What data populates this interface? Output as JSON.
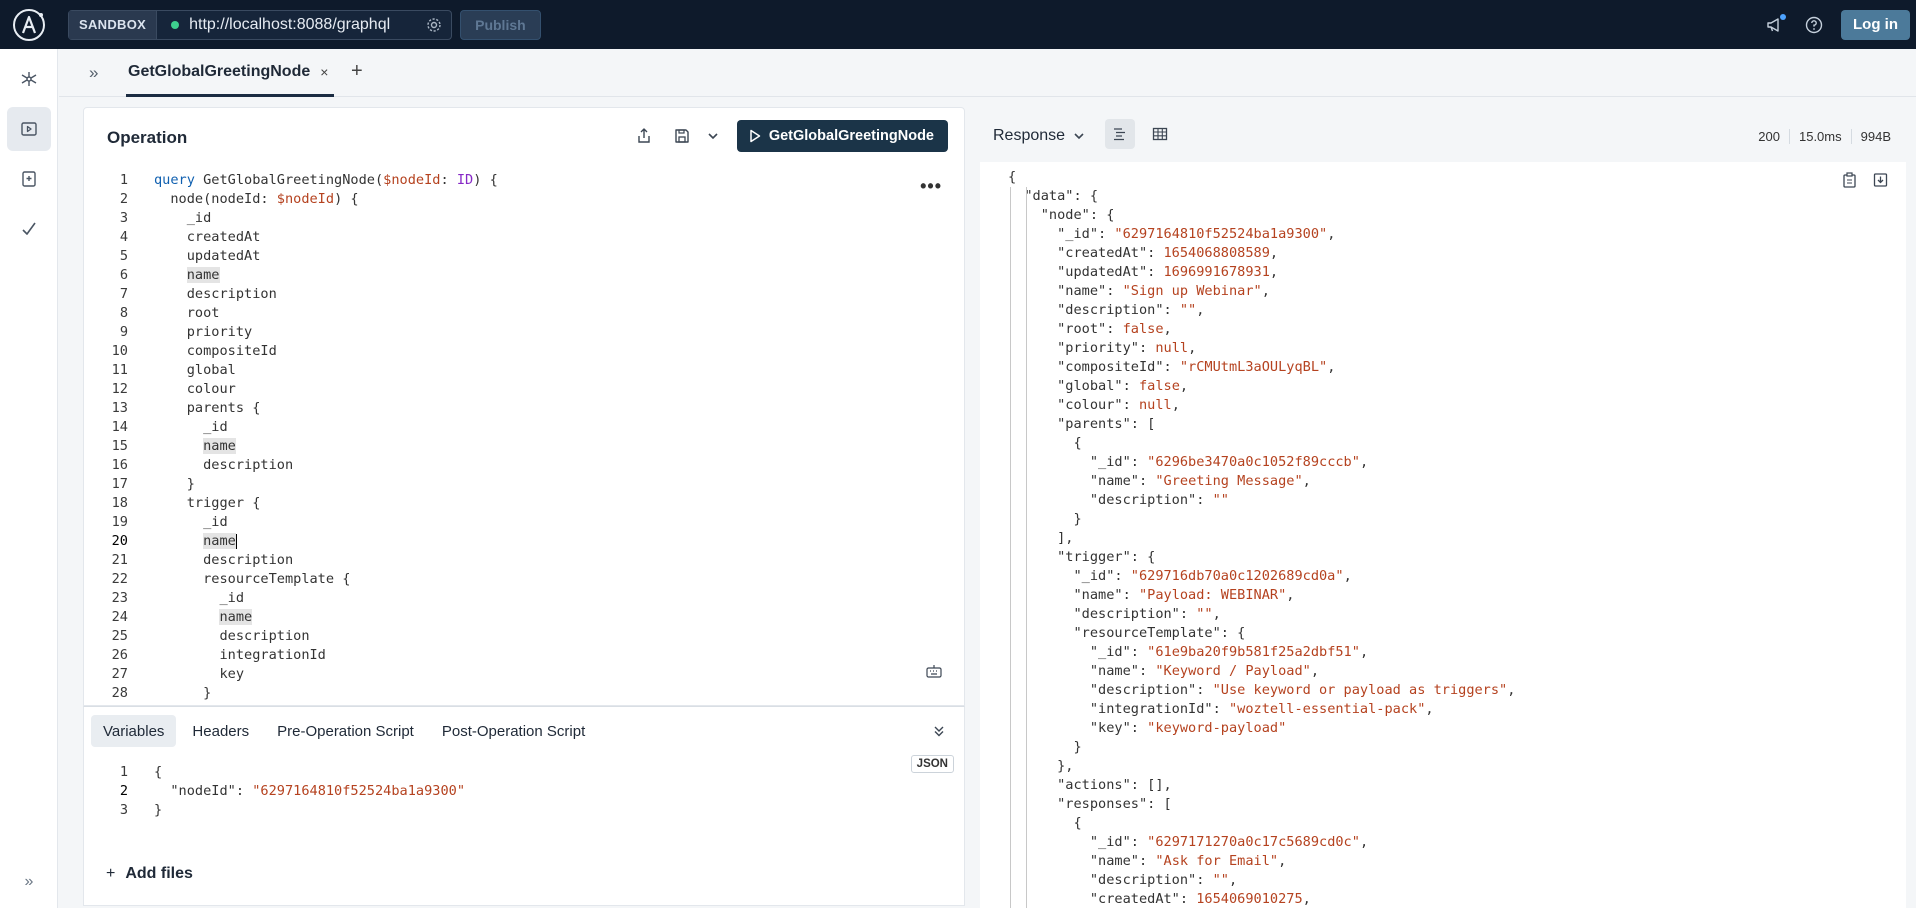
{
  "topbar": {
    "sandbox_label": "SANDBOX",
    "url": "http://localhost:8088/graphql",
    "publish_label": "Publish",
    "login_label": "Log in"
  },
  "tabs": [
    {
      "label": "GetGlobalGreetingNode",
      "close": "×"
    }
  ],
  "operation": {
    "title": "Operation",
    "run_label": "GetGlobalGreetingNode",
    "more": "•••",
    "code_lines": [
      [
        [
          "kw",
          "query"
        ],
        [
          "p",
          " GetGlobalGreetingNode("
        ],
        [
          "var",
          "$nodeId"
        ],
        [
          "p",
          ": "
        ],
        [
          "typ",
          "ID"
        ],
        [
          "p",
          ") {"
        ]
      ],
      [
        [
          "p",
          "  node(nodeId: "
        ],
        [
          "var",
          "$nodeId"
        ],
        [
          "p",
          ") {"
        ]
      ],
      [
        [
          "p",
          "    _id"
        ]
      ],
      [
        [
          "p",
          "    createdAt"
        ]
      ],
      [
        [
          "p",
          "    updatedAt"
        ]
      ],
      [
        [
          "p",
          "    "
        ],
        [
          "hl",
          "name"
        ]
      ],
      [
        [
          "p",
          "    description"
        ]
      ],
      [
        [
          "p",
          "    root"
        ]
      ],
      [
        [
          "p",
          "    priority"
        ]
      ],
      [
        [
          "p",
          "    compositeId"
        ]
      ],
      [
        [
          "p",
          "    global"
        ]
      ],
      [
        [
          "p",
          "    colour"
        ]
      ],
      [
        [
          "p",
          "    parents {"
        ]
      ],
      [
        [
          "p",
          "      _id"
        ]
      ],
      [
        [
          "p",
          "      "
        ],
        [
          "hl",
          "name"
        ]
      ],
      [
        [
          "p",
          "      description"
        ]
      ],
      [
        [
          "p",
          "    }"
        ]
      ],
      [
        [
          "p",
          "    trigger {"
        ]
      ],
      [
        [
          "p",
          "      _id"
        ]
      ],
      [
        [
          "p",
          "      "
        ],
        [
          "hl",
          "name"
        ],
        [
          "caret",
          ""
        ]
      ],
      [
        [
          "p",
          "      description"
        ]
      ],
      [
        [
          "p",
          "      resourceTemplate {"
        ]
      ],
      [
        [
          "p",
          "        _id"
        ]
      ],
      [
        [
          "p",
          "        "
        ],
        [
          "hl",
          "name"
        ]
      ],
      [
        [
          "p",
          "        description"
        ]
      ],
      [
        [
          "p",
          "        integrationId"
        ]
      ],
      [
        [
          "p",
          "        key"
        ]
      ],
      [
        [
          "p",
          "      }"
        ]
      ]
    ]
  },
  "variables": {
    "tabs": [
      "Variables",
      "Headers",
      "Pre-Operation Script",
      "Post-Operation Script"
    ],
    "badge": "JSON",
    "code_lines": [
      [
        [
          "p",
          "{"
        ]
      ],
      [
        [
          "p",
          "  \"nodeId\": "
        ],
        [
          "str",
          "\"6297164810f52524ba1a9300\""
        ]
      ],
      [
        [
          "p",
          "}"
        ]
      ]
    ],
    "add_files_label": "Add files"
  },
  "response": {
    "label": "Response",
    "status": "200",
    "time": "15.0ms",
    "size": "994B",
    "lines": [
      [
        [
          "p",
          "{"
        ]
      ],
      [
        [
          "p",
          "  \"data\": {"
        ]
      ],
      [
        [
          "p",
          "    \"node\": {"
        ]
      ],
      [
        [
          "p",
          "      \"_id\": "
        ],
        [
          "str",
          "\"6297164810f52524ba1a9300\""
        ],
        [
          "p",
          ","
        ]
      ],
      [
        [
          "p",
          "      \"createdAt\": "
        ],
        [
          "str",
          "1654068808589"
        ],
        [
          "p",
          ","
        ]
      ],
      [
        [
          "p",
          "      \"updatedAt\": "
        ],
        [
          "str",
          "1696991678931"
        ],
        [
          "p",
          ","
        ]
      ],
      [
        [
          "p",
          "      \"name\": "
        ],
        [
          "str",
          "\"Sign up Webinar\""
        ],
        [
          "p",
          ","
        ]
      ],
      [
        [
          "p",
          "      \"description\": "
        ],
        [
          "str",
          "\"\""
        ],
        [
          "p",
          ","
        ]
      ],
      [
        [
          "p",
          "      \"root\": "
        ],
        [
          "str",
          "false"
        ],
        [
          "p",
          ","
        ]
      ],
      [
        [
          "p",
          "      \"priority\": "
        ],
        [
          "str",
          "null"
        ],
        [
          "p",
          ","
        ]
      ],
      [
        [
          "p",
          "      \"compositeId\": "
        ],
        [
          "str",
          "\"rCMUtmL3aOULyqBL\""
        ],
        [
          "p",
          ","
        ]
      ],
      [
        [
          "p",
          "      \"global\": "
        ],
        [
          "str",
          "false"
        ],
        [
          "p",
          ","
        ]
      ],
      [
        [
          "p",
          "      \"colour\": "
        ],
        [
          "str",
          "null"
        ],
        [
          "p",
          ","
        ]
      ],
      [
        [
          "p",
          "      \"parents\": ["
        ]
      ],
      [
        [
          "p",
          "        {"
        ]
      ],
      [
        [
          "p",
          "          \"_id\": "
        ],
        [
          "str",
          "\"6296be3470a0c1052f89cccb\""
        ],
        [
          "p",
          ","
        ]
      ],
      [
        [
          "p",
          "          \"name\": "
        ],
        [
          "str",
          "\"Greeting Message\""
        ],
        [
          "p",
          ","
        ]
      ],
      [
        [
          "p",
          "          \"description\": "
        ],
        [
          "str",
          "\"\""
        ]
      ],
      [
        [
          "p",
          "        }"
        ]
      ],
      [
        [
          "p",
          "      ],"
        ]
      ],
      [
        [
          "p",
          "      \"trigger\": {"
        ]
      ],
      [
        [
          "p",
          "        \"_id\": "
        ],
        [
          "str",
          "\"629716db70a0c1202689cd0a\""
        ],
        [
          "p",
          ","
        ]
      ],
      [
        [
          "p",
          "        \"name\": "
        ],
        [
          "str",
          "\"Payload: WEBINAR\""
        ],
        [
          "p",
          ","
        ]
      ],
      [
        [
          "p",
          "        \"description\": "
        ],
        [
          "str",
          "\"\""
        ],
        [
          "p",
          ","
        ]
      ],
      [
        [
          "p",
          "        \"resourceTemplate\": {"
        ]
      ],
      [
        [
          "p",
          "          \"_id\": "
        ],
        [
          "str",
          "\"61e9ba20f9b581f25a2dbf51\""
        ],
        [
          "p",
          ","
        ]
      ],
      [
        [
          "p",
          "          \"name\": "
        ],
        [
          "str",
          "\"Keyword / Payload\""
        ],
        [
          "p",
          ","
        ]
      ],
      [
        [
          "p",
          "          \"description\": "
        ],
        [
          "str",
          "\"Use keyword or payload as triggers\""
        ],
        [
          "p",
          ","
        ]
      ],
      [
        [
          "p",
          "          \"integrationId\": "
        ],
        [
          "str",
          "\"woztell-essential-pack\""
        ],
        [
          "p",
          ","
        ]
      ],
      [
        [
          "p",
          "          \"key\": "
        ],
        [
          "str",
          "\"keyword-payload\""
        ]
      ],
      [
        [
          "p",
          "        }"
        ]
      ],
      [
        [
          "p",
          "      },"
        ]
      ],
      [
        [
          "p",
          "      \"actions\": [],"
        ]
      ],
      [
        [
          "p",
          "      \"responses\": ["
        ]
      ],
      [
        [
          "p",
          "        {"
        ]
      ],
      [
        [
          "p",
          "          \"_id\": "
        ],
        [
          "str",
          "\"6297171270a0c17c5689cd0c\""
        ],
        [
          "p",
          ","
        ]
      ],
      [
        [
          "p",
          "          \"name\": "
        ],
        [
          "str",
          "\"Ask for Email\""
        ],
        [
          "p",
          ","
        ]
      ],
      [
        [
          "p",
          "          \"description\": "
        ],
        [
          "str",
          "\"\""
        ],
        [
          "p",
          ","
        ]
      ],
      [
        [
          "p",
          "          \"createdAt\": "
        ],
        [
          "str",
          "1654069010275"
        ],
        [
          "p",
          ","
        ]
      ]
    ]
  },
  "colors": {
    "topbar_bg": "#0e1a2b",
    "run_button": "#1b3448",
    "login_button": "#4c7a9a",
    "keyword": "#1060b0",
    "variable": "#b5421f",
    "type": "#8628c6",
    "string": "#b5421f"
  }
}
